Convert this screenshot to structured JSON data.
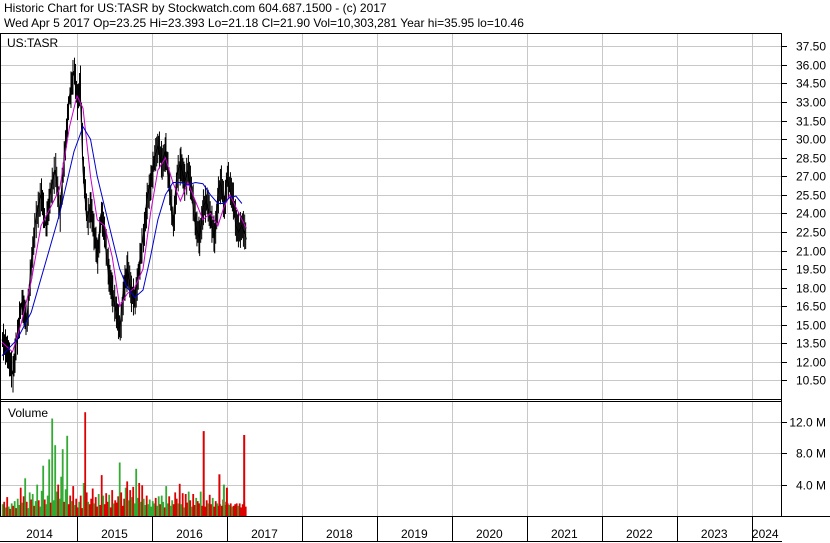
{
  "header": {
    "line1": "Historic Chart for US:TASR by Stockwatch.com 604.687.1500 - (c) 2017",
    "line2": "Wed Apr  5 2017  Op=23.25  Hi=23.393  Lo=21.18  Cl=21.90  Vol=10,303,281  Year hi=35.95  lo=10.46"
  },
  "colors": {
    "price": "#000000",
    "ma_fast": "#cc00cc",
    "ma_slow": "#0000cc",
    "volume_up": "#33aa33",
    "volume_down": "#dd0000",
    "grid": "#c8c8c8"
  },
  "chart_data": [
    {
      "type": "line",
      "label": "US:TASR",
      "grid": true,
      "ylim": [
        9.0,
        38.5
      ],
      "yticks": [
        "37.50",
        "36.00",
        "34.50",
        "33.00",
        "31.50",
        "30.00",
        "28.50",
        "27.00",
        "25.50",
        "24.00",
        "22.50",
        "21.00",
        "19.50",
        "18.00",
        "16.50",
        "15.00",
        "13.50",
        "12.00",
        "10.50"
      ],
      "xlim": [
        2014.0,
        2024.35
      ],
      "xticks": [
        "2014",
        "2015",
        "2016",
        "2017",
        "2018",
        "2019",
        "2020",
        "2021",
        "2022",
        "2023",
        "2024"
      ],
      "series": [
        {
          "style": "price",
          "x": [
            2014.0,
            2014.08,
            2014.14,
            2014.2,
            2014.26,
            2014.33,
            2014.39,
            2014.45,
            2014.52,
            2014.58,
            2014.65,
            2014.71,
            2014.77,
            2014.84,
            2014.9,
            2014.96,
            2015.0,
            2015.04,
            2015.08,
            2015.13,
            2015.18,
            2015.22,
            2015.27,
            2015.32,
            2015.37,
            2015.42,
            2015.47,
            2015.52,
            2015.57,
            2015.62,
            2015.67,
            2015.72,
            2015.77,
            2015.82,
            2015.88,
            2015.93,
            2015.98,
            2016.03,
            2016.08,
            2016.13,
            2016.18,
            2016.23,
            2016.28,
            2016.33,
            2016.38,
            2016.43,
            2016.48,
            2016.53,
            2016.58,
            2016.63,
            2016.68,
            2016.73,
            2016.78,
            2016.83,
            2016.88,
            2016.92,
            2016.96,
            2017.0,
            2017.04,
            2017.08,
            2017.12,
            2017.16,
            2017.2,
            2017.23,
            2017.26
          ],
          "y": [
            13.8,
            12.6,
            11.0,
            14.0,
            16.8,
            15.2,
            20.0,
            23.5,
            25.5,
            23.0,
            25.8,
            27.5,
            24.0,
            29.5,
            33.5,
            35.5,
            33.0,
            34.5,
            27.5,
            23.5,
            24.5,
            22.5,
            20.5,
            24.0,
            22.0,
            19.0,
            17.5,
            16.0,
            14.5,
            18.0,
            19.5,
            17.5,
            17.0,
            19.5,
            22.0,
            25.0,
            26.5,
            28.5,
            29.5,
            28.0,
            29.0,
            26.0,
            23.0,
            27.0,
            28.0,
            26.5,
            27.5,
            25.5,
            23.0,
            22.0,
            24.5,
            25.0,
            23.5,
            22.0,
            25.5,
            26.5,
            24.5,
            27.0,
            26.0,
            25.0,
            23.0,
            22.5,
            23.0,
            22.5,
            21.9
          ]
        },
        {
          "style": "ma_fast",
          "x": [
            2014.0,
            2014.14,
            2014.26,
            2014.39,
            2014.52,
            2014.65,
            2014.77,
            2014.9,
            2015.0,
            2015.08,
            2015.18,
            2015.27,
            2015.37,
            2015.47,
            2015.57,
            2015.67,
            2015.77,
            2015.88,
            2015.98,
            2016.08,
            2016.18,
            2016.28,
            2016.38,
            2016.48,
            2016.58,
            2016.68,
            2016.78,
            2016.88,
            2016.96,
            2017.04,
            2017.12,
            2017.2,
            2017.26
          ],
          "y": [
            13.6,
            12.8,
            15.2,
            18.5,
            23.0,
            24.5,
            26.0,
            31.0,
            33.5,
            32.5,
            27.0,
            23.5,
            23.0,
            20.5,
            16.5,
            17.5,
            18.0,
            19.5,
            24.0,
            27.5,
            28.5,
            26.5,
            25.0,
            26.5,
            25.0,
            23.5,
            24.0,
            23.0,
            24.5,
            25.5,
            24.5,
            23.5,
            22.8
          ]
        },
        {
          "style": "ma_slow",
          "x": [
            2014.0,
            2014.2,
            2014.39,
            2014.58,
            2014.77,
            2014.96,
            2015.08,
            2015.18,
            2015.27,
            2015.37,
            2015.47,
            2015.57,
            2015.67,
            2015.77,
            2015.88,
            2015.98,
            2016.08,
            2016.18,
            2016.28,
            2016.38,
            2016.48,
            2016.58,
            2016.68,
            2016.78,
            2016.88,
            2016.96,
            2017.04,
            2017.12,
            2017.2
          ],
          "y": [
            12.5,
            13.8,
            16.0,
            20.0,
            24.0,
            29.0,
            31.0,
            30.0,
            27.0,
            24.5,
            22.0,
            19.5,
            18.0,
            17.2,
            17.8,
            20.5,
            23.5,
            25.5,
            26.5,
            26.5,
            26.3,
            26.5,
            26.4,
            25.5,
            24.8,
            24.8,
            25.3,
            25.4,
            24.8
          ]
        }
      ]
    },
    {
      "type": "bar",
      "label": "Volume",
      "ylim": [
        0,
        14.5
      ],
      "yticks": [
        "12.0 M",
        "8.0 M",
        "4.0 M"
      ],
      "xlim": [
        2014.0,
        2024.35
      ],
      "x": [
        2014.01,
        2014.03,
        2014.05,
        2014.07,
        2014.09,
        2014.11,
        2014.13,
        2014.15,
        2014.17,
        2014.19,
        2014.21,
        2014.23,
        2014.25,
        2014.27,
        2014.29,
        2014.31,
        2014.33,
        2014.35,
        2014.37,
        2014.39,
        2014.41,
        2014.43,
        2014.45,
        2014.47,
        2014.49,
        2014.51,
        2014.53,
        2014.55,
        2014.57,
        2014.59,
        2014.61,
        2014.63,
        2014.65,
        2014.67,
        2014.69,
        2014.71,
        2014.73,
        2014.75,
        2014.77,
        2014.79,
        2014.81,
        2014.83,
        2014.85,
        2014.87,
        2014.89,
        2014.91,
        2014.93,
        2014.95,
        2014.97,
        2014.99,
        2015.01,
        2015.03,
        2015.05,
        2015.07,
        2015.09,
        2015.11,
        2015.13,
        2015.15,
        2015.17,
        2015.19,
        2015.21,
        2015.23,
        2015.25,
        2015.27,
        2015.29,
        2015.31,
        2015.33,
        2015.35,
        2015.37,
        2015.39,
        2015.41,
        2015.43,
        2015.45,
        2015.47,
        2015.49,
        2015.51,
        2015.53,
        2015.55,
        2015.57,
        2015.59,
        2015.61,
        2015.63,
        2015.65,
        2015.67,
        2015.69,
        2015.71,
        2015.73,
        2015.75,
        2015.77,
        2015.79,
        2015.81,
        2015.83,
        2015.85,
        2015.87,
        2015.89,
        2015.91,
        2015.93,
        2015.95,
        2015.97,
        2015.99,
        2016.01,
        2016.03,
        2016.05,
        2016.07,
        2016.09,
        2016.11,
        2016.13,
        2016.15,
        2016.17,
        2016.19,
        2016.21,
        2016.23,
        2016.25,
        2016.27,
        2016.29,
        2016.31,
        2016.33,
        2016.35,
        2016.37,
        2016.39,
        2016.41,
        2016.43,
        2016.45,
        2016.47,
        2016.49,
        2016.51,
        2016.53,
        2016.55,
        2016.57,
        2016.59,
        2016.61,
        2016.63,
        2016.65,
        2016.67,
        2016.69,
        2016.71,
        2016.73,
        2016.75,
        2016.77,
        2016.79,
        2016.81,
        2016.83,
        2016.85,
        2016.87,
        2016.89,
        2016.91,
        2016.93,
        2016.95,
        2016.97,
        2016.99,
        2017.01,
        2017.03,
        2017.05,
        2017.07,
        2017.09,
        2017.11,
        2017.13,
        2017.15,
        2017.17,
        2017.19,
        2017.21,
        2017.23,
        2017.25
      ],
      "values": [
        1.5,
        1.8,
        1.1,
        2.4,
        1.2,
        0.9,
        1.6,
        1.3,
        1.9,
        1.0,
        2.2,
        1.4,
        3.6,
        1.7,
        2.5,
        4.8,
        1.8,
        1.0,
        3.0,
        2.1,
        2.8,
        1.3,
        1.9,
        4.0,
        2.0,
        1.2,
        3.2,
        6.4,
        2.1,
        1.5,
        2.6,
        7.2,
        1.7,
        12.4,
        2.0,
        9.0,
        3.1,
        4.0,
        2.2,
        5.0,
        8.5,
        1.8,
        3.4,
        10.2,
        1.5,
        2.6,
        1.9,
        3.8,
        1.4,
        2.2,
        1.1,
        1.8,
        2.6,
        1.0,
        4.2,
        13.2,
        3.0,
        1.8,
        1.5,
        2.2,
        3.5,
        1.6,
        2.4,
        1.2,
        2.8,
        1.4,
        5.2,
        2.6,
        1.5,
        2.9,
        1.8,
        2.7,
        1.1,
        3.3,
        1.6,
        2.0,
        1.7,
        2.5,
        6.8,
        3.0,
        1.3,
        2.2,
        3.6,
        4.4,
        2.0,
        3.3,
        2.4,
        3.7,
        1.6,
        6.0,
        2.3,
        4.2,
        1.8,
        3.9,
        2.2,
        1.4,
        2.6,
        1.5,
        2.1,
        1.2,
        1.9,
        1.6,
        2.3,
        1.3,
        2.5,
        1.5,
        2.6,
        1.8,
        1.1,
        3.8,
        1.6,
        2.5,
        1.3,
        2.0,
        1.5,
        3.0,
        2.2,
        1.6,
        4.1,
        1.5,
        2.9,
        1.1,
        2.8,
        1.7,
        3.1,
        2.0,
        1.2,
        2.8,
        1.4,
        2.3,
        1.9,
        1.6,
        3.1,
        1.3,
        2.9,
        1.2,
        2.0,
        1.6,
        2.7,
        1.5,
        2.3,
        1.2,
        1.9,
        1.6,
        1.3,
        1.5,
        1.3,
        2.1,
        1.4,
        1.8,
        1.6,
        1.4,
        1.6,
        1.2,
        1.3,
        1.5,
        1.6,
        1.3,
        1.6,
        1.1,
        1.5,
        1.8,
        1.2
      ],
      "up": [
        true,
        false,
        true,
        false,
        true,
        false,
        true,
        false,
        true,
        false,
        true,
        true,
        false,
        true,
        false,
        true,
        false,
        true,
        true,
        false,
        true,
        false,
        true,
        true,
        false,
        true,
        true,
        true,
        false,
        true,
        true,
        true,
        false,
        true,
        true,
        true,
        true,
        false,
        true,
        true,
        true,
        false,
        true,
        true,
        false,
        false,
        true,
        false,
        true,
        false,
        false,
        true,
        false,
        false,
        true,
        false,
        false,
        true,
        false,
        false,
        false,
        true,
        false,
        false,
        true,
        false,
        false,
        true,
        false,
        false,
        false,
        true,
        false,
        false,
        true,
        false,
        false,
        false,
        true,
        false,
        false,
        false,
        true,
        false,
        true,
        false,
        true,
        false,
        true,
        true,
        true,
        false,
        true,
        false,
        true,
        true,
        false,
        true,
        true,
        true,
        true,
        true,
        false,
        true,
        true,
        false,
        true,
        true,
        false,
        true,
        true,
        false,
        true,
        true,
        false,
        false,
        false,
        true,
        false,
        true,
        false,
        true,
        false,
        false,
        true,
        false,
        true,
        false,
        false,
        true,
        false,
        false,
        true,
        false,
        true,
        false,
        false,
        true,
        false,
        false,
        true,
        false,
        false,
        true,
        false,
        true,
        false,
        false,
        true,
        false,
        false,
        true,
        false,
        true,
        false,
        false,
        false,
        true,
        false,
        false,
        false
      ],
      "spikes": [
        {
          "x": 2016.69,
          "value": 10.8,
          "up": false
        },
        {
          "x": 2016.9,
          "value": 5.3,
          "up": false
        },
        {
          "x": 2016.96,
          "value": 4.0,
          "up": true
        },
        {
          "x": 2017.0,
          "value": 3.6,
          "up": false
        },
        {
          "x": 2017.23,
          "value": 10.3,
          "up": false
        }
      ]
    }
  ]
}
